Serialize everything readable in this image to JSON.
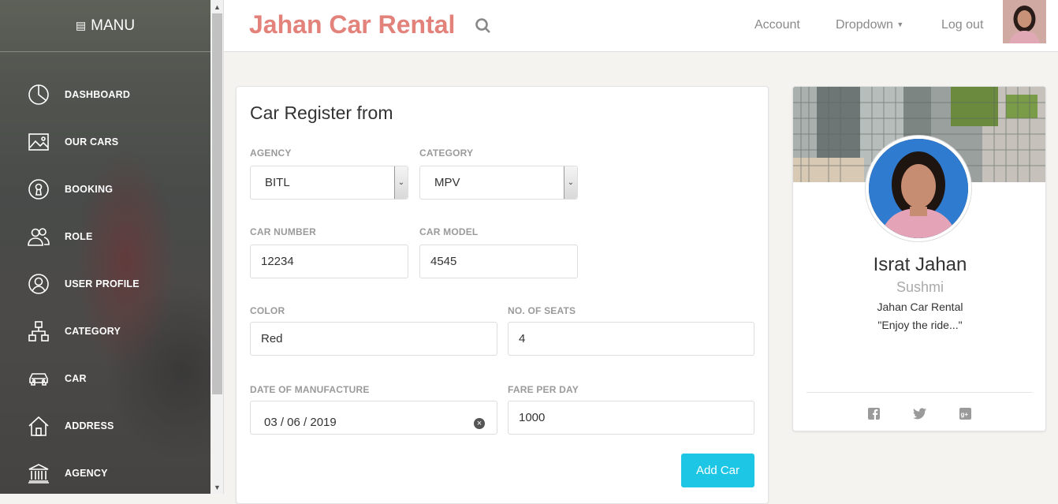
{
  "sidebar": {
    "brand": "MANU",
    "items": [
      {
        "label": "DASHBOARD",
        "icon": "pie-chart-icon"
      },
      {
        "label": "OUR CARS",
        "icon": "image-icon"
      },
      {
        "label": "BOOKING",
        "icon": "keyhole-icon"
      },
      {
        "label": "ROLE",
        "icon": "users-icon"
      },
      {
        "label": "USER PROFILE",
        "icon": "user-circle-icon"
      },
      {
        "label": "CATEGORY",
        "icon": "hierarchy-icon"
      },
      {
        "label": "CAR",
        "icon": "car-icon"
      },
      {
        "label": "ADDRESS",
        "icon": "home-icon"
      },
      {
        "label": "AGENCY",
        "icon": "bank-icon"
      }
    ]
  },
  "header": {
    "title": "Jahan Car Rental",
    "nav": {
      "account": "Account",
      "dropdown": "Dropdown",
      "logout": "Log out"
    }
  },
  "form": {
    "title": "Car Register from",
    "agency": {
      "label": "AGENCY",
      "value": "BITL"
    },
    "category": {
      "label": "CATEGORY",
      "value": "MPV"
    },
    "car_number": {
      "label": "CAR NUMBER",
      "value": "12234"
    },
    "car_model": {
      "label": "CAR MODEL",
      "value": "4545"
    },
    "color": {
      "label": "COLOR",
      "value": "Red"
    },
    "seats": {
      "label": "NO. OF SEATS",
      "value": "4"
    },
    "manufacture_date": {
      "label": "DATE OF MANUFACTURE",
      "value": "03 / 06 / 2019"
    },
    "fare": {
      "label": "FARE PER DAY",
      "value": "1000"
    },
    "submit": "Add Car"
  },
  "profile": {
    "name": "Israt Jahan",
    "nickname": "Sushmi",
    "company": "Jahan Car Rental",
    "quote": "\"Enjoy the ride...\"",
    "social": [
      "facebook-icon",
      "twitter-icon",
      "google-plus-icon"
    ]
  },
  "colors": {
    "brand": "#e3817b",
    "button": "#1ec6e6"
  }
}
